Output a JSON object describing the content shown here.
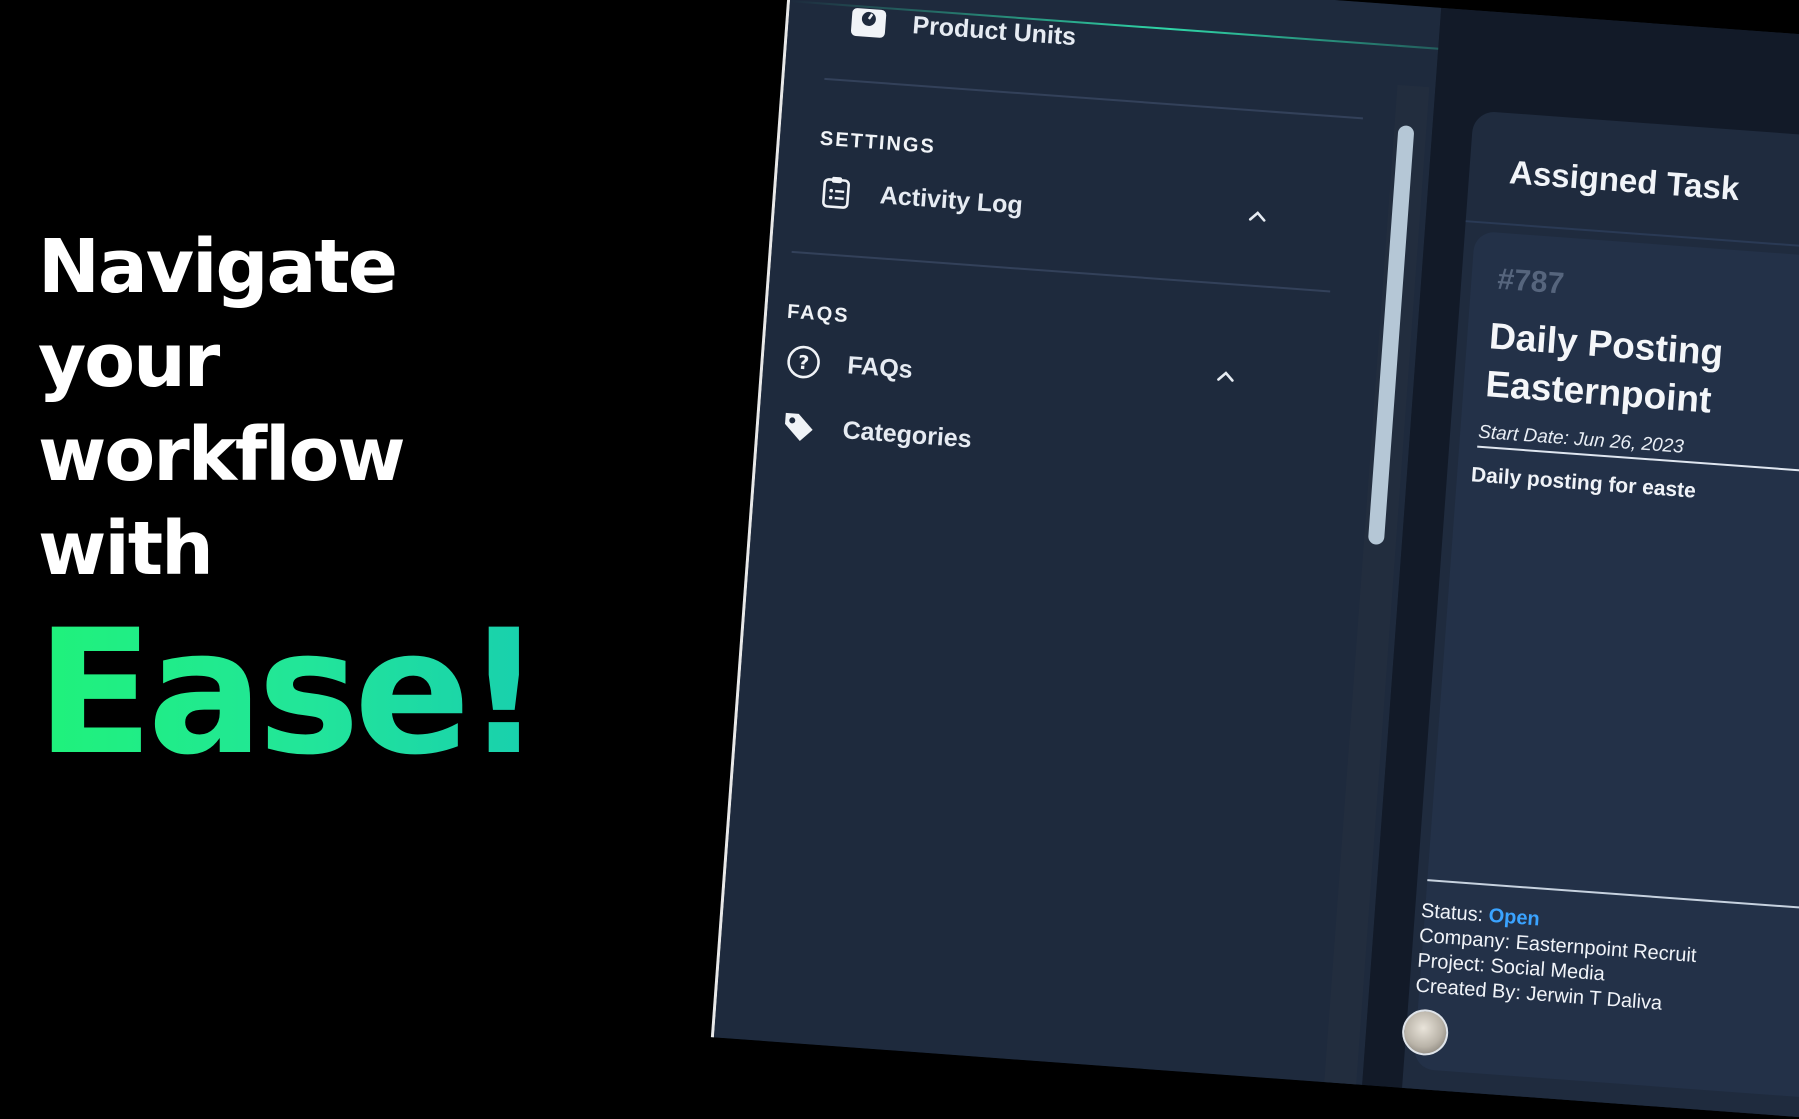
{
  "promo": {
    "headline_lines": [
      "Navigate",
      "your",
      "workflow",
      "with"
    ],
    "accent": "Ease!"
  },
  "sidebar": {
    "top_item": {
      "label": "Product Units",
      "icon": "scale-icon"
    },
    "sections": [
      {
        "title": "SETTINGS",
        "items": [
          {
            "label": "Activity Log",
            "icon": "clipboard-list-icon"
          }
        ]
      },
      {
        "title": "FAQS",
        "items": [
          {
            "label": "FAQs",
            "icon": "question-circle-icon"
          },
          {
            "label": "Categories",
            "icon": "tag-icon"
          }
        ]
      }
    ]
  },
  "main": {
    "panel_title": "Assigned Task",
    "task": {
      "id": "#787",
      "title_lines": [
        "Daily Posting",
        "Easternpoint"
      ],
      "start_date": "Start Date: Jun 26, 2023",
      "description": "Daily posting for easte",
      "status_label": "Status: ",
      "status_value": "Open",
      "company": "Company: Easternpoint Recruit",
      "project": "Project: Social Media",
      "created_by": "Created By: Jerwin T Daliva"
    }
  },
  "colors": {
    "accent_green": "#1ff27a",
    "accent_teal": "#18cfae",
    "status_open": "#3aa3ff",
    "sidebar_bg": "#1e2a3d"
  }
}
